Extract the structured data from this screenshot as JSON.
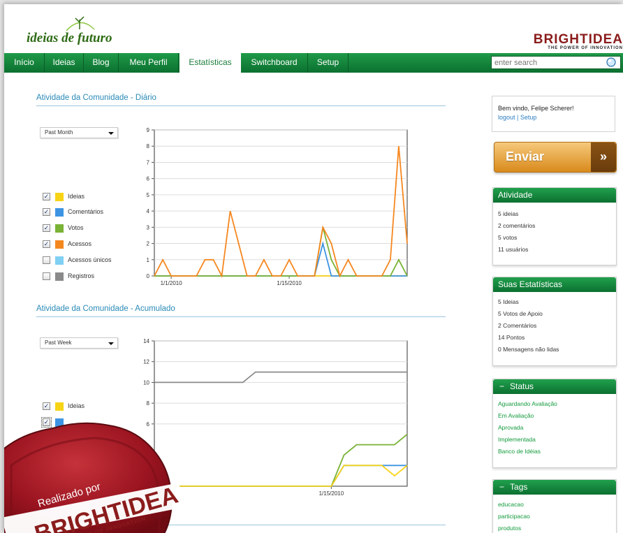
{
  "header": {
    "logo_text": "ideias de futuro",
    "brand_name": "BRIGHTIDEA",
    "brand_tagline": "THE POWER OF INNOVATION"
  },
  "nav": {
    "items": [
      {
        "label": "Início",
        "active": false
      },
      {
        "label": "Ideias",
        "active": false
      },
      {
        "label": "Blog",
        "active": false
      },
      {
        "label": "Meu Perfil",
        "active": false
      },
      {
        "label": "Estatísticas",
        "active": true
      },
      {
        "label": "Switchboard",
        "active": false
      },
      {
        "label": "Setup",
        "active": false
      }
    ],
    "search_placeholder": "enter search"
  },
  "daily": {
    "title": "Atividade da Comunidade - Diário",
    "period": "Past Month",
    "legend": [
      {
        "label": "Ideias",
        "checked": true,
        "color": "#f7d316"
      },
      {
        "label": "Comentários",
        "checked": true,
        "color": "#3d94e3"
      },
      {
        "label": "Votos",
        "checked": true,
        "color": "#7ab236"
      },
      {
        "label": "Acessos",
        "checked": true,
        "color": "#f5871f"
      },
      {
        "label": "Acessos únicos",
        "checked": false,
        "color": "#7fd0f2"
      },
      {
        "label": "Registros",
        "checked": false,
        "color": "#8a8a8a"
      }
    ]
  },
  "cumulative": {
    "title": "Atividade da Comunidade - Acumulado",
    "period": "Past Week",
    "legend": [
      {
        "label": "Ideias",
        "checked": true,
        "color": "#f7d316"
      }
    ]
  },
  "chart_data": [
    {
      "type": "line",
      "title": "Atividade da Comunidade - Diário",
      "xlabel": "",
      "ylabel": "",
      "ylim": [
        0,
        9
      ],
      "yticks": [
        0,
        1,
        2,
        3,
        4,
        5,
        6,
        7,
        8,
        9
      ],
      "xtick_labels": [
        {
          "label": "1/1/2010",
          "index": 2
        },
        {
          "label": "1/15/2010",
          "index": 16
        }
      ],
      "n_points": 31,
      "grid": true,
      "series": [
        {
          "name": "Ideias",
          "color": "#f7d316",
          "values": [
            0,
            0,
            0,
            0,
            0,
            0,
            0,
            0,
            0,
            0,
            0,
            0,
            0,
            0,
            0,
            0,
            0,
            0,
            0,
            0,
            0,
            0,
            0,
            0,
            0,
            0,
            0,
            0,
            0,
            0,
            0
          ]
        },
        {
          "name": "Comentários",
          "color": "#3d94e3",
          "values": [
            0,
            0,
            0,
            0,
            0,
            0,
            0,
            0,
            0,
            0,
            0,
            0,
            0,
            0,
            0,
            0,
            0,
            0,
            0,
            0,
            2,
            0,
            0,
            0,
            0,
            0,
            0,
            0,
            0,
            0,
            0
          ]
        },
        {
          "name": "Votos",
          "color": "#7ab236",
          "values": [
            0,
            0,
            0,
            0,
            0,
            0,
            0,
            0,
            0,
            0,
            0,
            0,
            0,
            0,
            0,
            0,
            0,
            0,
            0,
            0,
            3,
            1,
            0,
            0,
            0,
            0,
            0,
            0,
            0,
            1,
            0
          ]
        },
        {
          "name": "Acessos",
          "color": "#f5871f",
          "values": [
            0,
            1,
            0,
            0,
            0,
            0,
            1,
            1,
            0,
            4,
            2,
            0,
            0,
            1,
            0,
            0,
            1,
            0,
            0,
            0,
            3,
            2,
            0,
            1,
            0,
            0,
            0,
            0,
            1,
            8,
            2
          ]
        }
      ]
    },
    {
      "type": "line",
      "title": "Atividade da Comunidade - Acumulado",
      "xlabel": "",
      "ylabel": "",
      "ylim": [
        0,
        14
      ],
      "yticks": [
        6,
        8,
        10,
        12,
        14
      ],
      "xtick_labels": [
        {
          "label": "1/15/2010",
          "index": 14
        }
      ],
      "n_points": 21,
      "grid": true,
      "series": [
        {
          "name": "Registros",
          "color": "#8a8a8a",
          "values": [
            10,
            10,
            10,
            10,
            10,
            10,
            10,
            10,
            11,
            11,
            11,
            11,
            11,
            11,
            11,
            11,
            11,
            11,
            11,
            11,
            11
          ]
        },
        {
          "name": "Votos",
          "color": "#7ab236",
          "values": [
            0,
            0,
            0,
            0,
            0,
            0,
            0,
            0,
            0,
            0,
            0,
            0,
            0,
            0,
            0,
            3,
            4,
            4,
            4,
            4,
            5
          ]
        },
        {
          "name": "Comentários",
          "color": "#3d94e3",
          "values": [
            0,
            0,
            0,
            0,
            0,
            0,
            0,
            0,
            0,
            0,
            0,
            0,
            0,
            0,
            0,
            2,
            2,
            2,
            2,
            2,
            2
          ]
        },
        {
          "name": "Ideias",
          "color": "#f7d316",
          "values": [
            0,
            0,
            0,
            0,
            0,
            0,
            0,
            0,
            0,
            0,
            0,
            0,
            0,
            0,
            0,
            2,
            2,
            2,
            2,
            1,
            2
          ]
        }
      ]
    }
  ],
  "sidebar": {
    "welcome_text": "Bem vindo, Felipe Scherer!",
    "logout_link": "logout",
    "setup_link": "Setup",
    "link_sep": " | ",
    "enviar_label": "Enviar",
    "enviar_arrow": "»",
    "atividade": {
      "title": "Atividade",
      "items": [
        "5  ideias",
        "2  comentários",
        "5  votos",
        "11  usuários"
      ]
    },
    "estatisticas": {
      "title": "Suas Estatísticas",
      "items": [
        "5  Ideias",
        "5  Votos de Apoio",
        "2  Comentários",
        "14  Pontos",
        "0  Mensagens não lidas"
      ]
    },
    "status": {
      "title": "Status",
      "toggle": "−",
      "items": [
        "Aguardando Avaliação",
        "Em Avaliação",
        "Aprovada",
        "Implementada",
        "Banco de Idéias"
      ]
    },
    "tags": {
      "title": "Tags",
      "toggle": "−",
      "items": [
        "educacao",
        "participacao",
        "produtos"
      ]
    }
  },
  "seal": {
    "line1": "Realizado por",
    "brand": "BRIGHTIDEA",
    "tagline": "POWER OF INNOVATION"
  }
}
